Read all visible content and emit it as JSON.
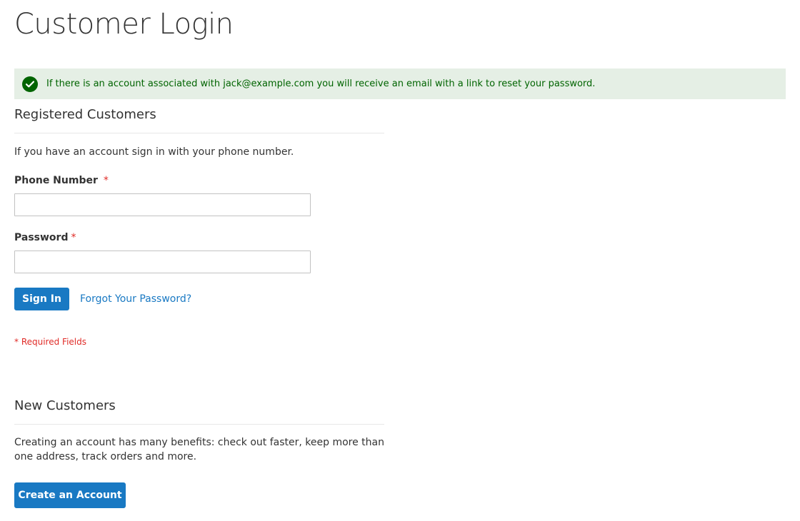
{
  "page": {
    "title": "Customer Login"
  },
  "message": {
    "icon": "checkmark-icon",
    "text": "If there is an account associated with jack@example.com you will receive an email with a link to reset your password.",
    "bg_color": "#e5efe5",
    "text_color": "#006400"
  },
  "registered": {
    "title": "Registered Customers",
    "intro": "If you have an account sign in with your phone number.",
    "phone_label": "Phone Number",
    "phone_value": "",
    "password_label": "Password",
    "password_value": "",
    "required_marker": "*",
    "sign_in_label": "Sign In",
    "forgot_label": "Forgot Your Password?",
    "required_note": "* Required Fields"
  },
  "new_customers": {
    "title": "New Customers",
    "text": "Creating an account has many benefits: check out faster, keep more than one address, track orders and more.",
    "create_label": "Create an Account"
  },
  "colors": {
    "primary": "#1979c3",
    "required": "#e02b27",
    "success": "#006400"
  }
}
